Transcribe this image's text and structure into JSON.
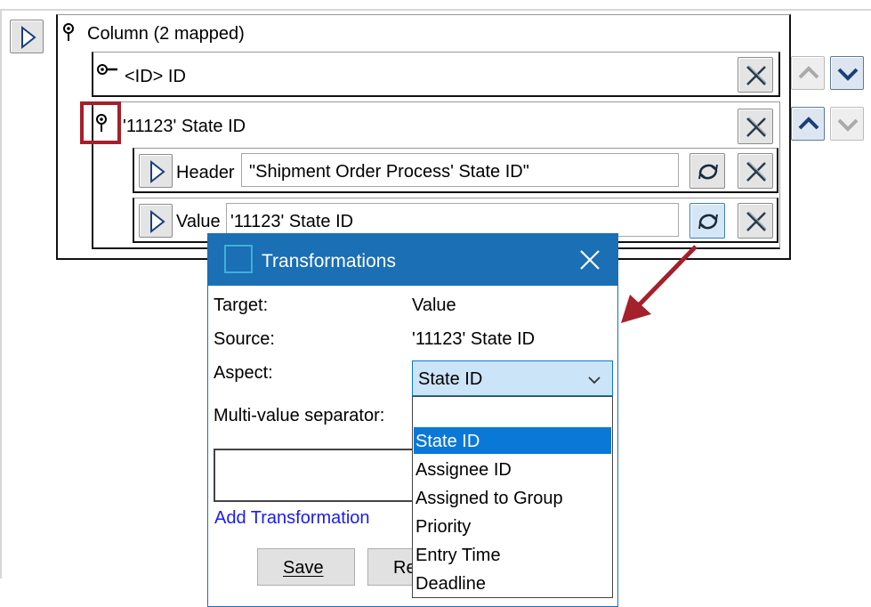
{
  "mapping": {
    "column_label": "Column (2 mapped)",
    "id_row_label": "<ID> ID",
    "state_row_label": "'11123' State ID",
    "header": {
      "label": "Header",
      "value": "\"Shipment Order Process' State ID\""
    },
    "value": {
      "label": "Value",
      "value": "'11123' State ID"
    }
  },
  "dialog": {
    "title": "Transformations",
    "target_label": "Target:",
    "target_value": "Value",
    "source_label": "Source:",
    "source_value": "'11123' State ID",
    "aspect_label": "Aspect:",
    "aspect_selected": "State ID",
    "multivalue_label": "Multi-value separator:",
    "add_transformation": "Add Transformation",
    "save": "Save",
    "reset_partial": "Re",
    "options": [
      "State ID",
      "Assignee ID",
      "Assigned to Group",
      "Priority",
      "Entry Time",
      "Deadline"
    ]
  },
  "colors": {
    "dialog_title_bg": "#1a6fb5",
    "selection": "#0a78d7",
    "annotation": "#a4202a",
    "link": "#1a1aff"
  },
  "icons": [
    "expand-arrow-icon",
    "pin-icon",
    "key-icon",
    "delete-icon",
    "transform-icon",
    "arrow-up-icon",
    "arrow-down-icon",
    "dialog-app-icon",
    "close-icon",
    "chevron-down-icon"
  ]
}
